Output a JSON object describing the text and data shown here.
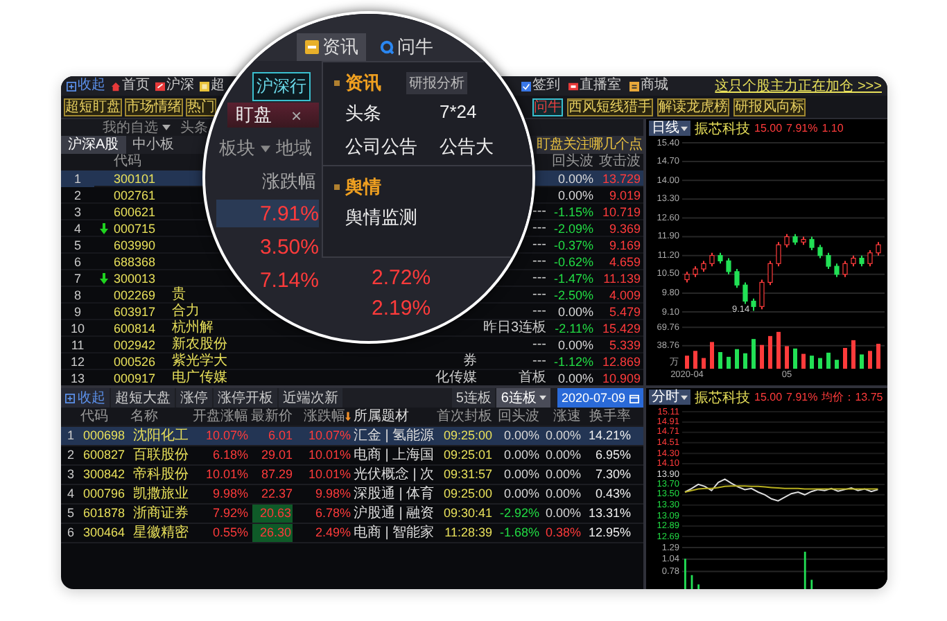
{
  "toolbar": {
    "left": [
      "收起",
      "首页",
      "沪深",
      "超"
    ],
    "right": [
      "签到",
      "直播室",
      "商城"
    ],
    "link": "这只个股主力正在加仓 >>>"
  },
  "quick_buttons": {
    "left": [
      {
        "label": "超短盯盘",
        "selected": false
      },
      {
        "label": "市场情绪",
        "selected": false
      },
      {
        "label": "热门",
        "selected": false
      }
    ],
    "right": [
      {
        "label": "问牛",
        "selected": true
      },
      {
        "label": "西风短线猎手",
        "selected": false
      },
      {
        "label": "解读龙虎榜",
        "selected": false
      },
      {
        "label": "研报风向标",
        "selected": false
      }
    ]
  },
  "watch": {
    "menu": "我的自选",
    "headline": "头条",
    "tabs": [
      {
        "label": "沪深A股",
        "selected": true
      },
      {
        "label": "中小板",
        "selected": false
      }
    ],
    "banner": "盯盘关注哪几个点",
    "columns": {
      "code": "代码",
      "rebound": "回头波",
      "attack": "攻击波"
    },
    "rows": [
      {
        "index": "1",
        "down": false,
        "code": "300101",
        "rebound": "0.00%",
        "falling": false,
        "attack": "13.729",
        "selected": true
      },
      {
        "index": "2",
        "down": false,
        "code": "002761",
        "rebound": "0.00%",
        "falling": false,
        "attack": "9.019",
        "selected": false
      },
      {
        "index": "3",
        "down": false,
        "code": "600621",
        "tag": "---",
        "rebound": "-1.15%",
        "falling": true,
        "attack": "10.719",
        "selected": false
      },
      {
        "index": "4",
        "down": true,
        "code": "000715",
        "tag": "---",
        "rebound": "-2.09%",
        "falling": true,
        "attack": "9.369",
        "selected": false
      },
      {
        "index": "5",
        "down": false,
        "code": "603990",
        "tag": "---",
        "rebound": "-0.37%",
        "falling": true,
        "attack": "9.169",
        "selected": false
      },
      {
        "index": "6",
        "down": false,
        "code": "688368",
        "tag": "---",
        "rebound": "-0.62%",
        "falling": true,
        "attack": "4.659",
        "selected": false
      },
      {
        "index": "7",
        "down": true,
        "code": "300013",
        "tag": "---",
        "rebound": "-1.47%",
        "falling": true,
        "attack": "11.139",
        "selected": false
      },
      {
        "index": "8",
        "down": false,
        "code": "002269",
        "name": "贵",
        "tag": "---",
        "rebound": "-2.50%",
        "falling": true,
        "attack": "4.009",
        "selected": false
      },
      {
        "index": "9",
        "down": false,
        "code": "603917",
        "name": "合力",
        "tag": "---",
        "rebound": "0.00%",
        "falling": false,
        "attack": "5.479",
        "selected": false
      },
      {
        "index": "10",
        "down": false,
        "code": "600814",
        "name": "杭州解",
        "tag": "昨日3连板",
        "rebound": "-2.11%",
        "falling": true,
        "attack": "15.429",
        "selected": false
      },
      {
        "index": "11",
        "down": false,
        "code": "002942",
        "name": "新农股份",
        "tag": "---",
        "rebound": "0.00%",
        "falling": false,
        "attack": "5.339",
        "selected": false
      },
      {
        "index": "12",
        "down": false,
        "code": "000526",
        "name": "紫光学大",
        "concept": "券",
        "tag": "---",
        "rebound": "-1.12%",
        "falling": true,
        "attack": "12.869",
        "selected": false
      },
      {
        "index": "13",
        "down": false,
        "code": "000917",
        "name": "电广传媒",
        "concept": "化传媒",
        "tag": "首板",
        "rebound": "0.00%",
        "falling": false,
        "attack": "10.909",
        "selected": false
      }
    ]
  },
  "board": {
    "collapse": "收起",
    "tabs": [
      {
        "label": "超短大盘",
        "selected": false,
        "dropdown": false
      },
      {
        "label": "涨停",
        "selected": false,
        "dropdown": false
      },
      {
        "label": "涨停开板",
        "selected": false,
        "dropdown": false
      },
      {
        "label": "近端次新",
        "selected": false,
        "dropdown": false
      },
      {
        "label": "5连板",
        "selected": false,
        "dropdown": false
      },
      {
        "label": "6连板",
        "selected": true,
        "dropdown": true
      }
    ],
    "date": "2020-07-09",
    "columns": [
      {
        "label": "代码",
        "sorted": false
      },
      {
        "label": "名称",
        "sorted": false
      },
      {
        "label": "开盘涨幅",
        "sorted": false
      },
      {
        "label": "最新价",
        "sorted": false
      },
      {
        "label": "涨跌幅",
        "sorted": true
      },
      {
        "label": "所属题材",
        "sorted": false
      },
      {
        "label": "首次封板",
        "sorted": false
      },
      {
        "label": "回头波",
        "sorted": false
      },
      {
        "label": "涨速",
        "sorted": false
      },
      {
        "label": "换手率",
        "sorted": false
      }
    ],
    "rows": [
      {
        "index": "1",
        "code": "000698",
        "name": "沈阳化工",
        "open": "10.07%",
        "price": "6.01",
        "price_flash": false,
        "change": "10.07%",
        "concept": "汇金 | 氢能源",
        "time": "09:25:00",
        "rebound": "0.00%",
        "rebound_falling": false,
        "speed": "0.00%",
        "speed_rising": false,
        "turnover": "14.21%",
        "selected": true
      },
      {
        "index": "2",
        "code": "600827",
        "name": "百联股份",
        "open": "6.18%",
        "price": "29.01",
        "price_flash": false,
        "change": "10.01%",
        "concept": "电商 | 上海国",
        "time": "09:25:01",
        "rebound": "0.00%",
        "rebound_falling": false,
        "speed": "0.00%",
        "speed_rising": false,
        "turnover": "6.95%",
        "selected": false
      },
      {
        "index": "3",
        "code": "300842",
        "name": "帝科股份",
        "open": "10.01%",
        "price": "87.29",
        "price_flash": false,
        "change": "10.01%",
        "concept": "光伏概念 | 次",
        "time": "09:31:57",
        "rebound": "0.00%",
        "rebound_falling": false,
        "speed": "0.00%",
        "speed_rising": false,
        "turnover": "7.30%",
        "selected": false
      },
      {
        "index": "4",
        "code": "000796",
        "name": "凯撒旅业",
        "open": "9.98%",
        "price": "22.37",
        "price_flash": false,
        "change": "9.98%",
        "concept": "深股通 | 体育",
        "time": "09:25:00",
        "rebound": "0.00%",
        "rebound_falling": false,
        "speed": "0.00%",
        "speed_rising": false,
        "turnover": "0.43%",
        "selected": false
      },
      {
        "index": "5",
        "code": "601878",
        "name": "浙商证券",
        "open": "7.92%",
        "price": "20.63",
        "price_flash": true,
        "change": "6.78%",
        "concept": "沪股通 | 融资",
        "time": "09:30:41",
        "rebound": "-2.92%",
        "rebound_falling": true,
        "speed": "0.00%",
        "speed_rising": false,
        "turnover": "13.31%",
        "selected": false
      },
      {
        "index": "6",
        "code": "300464",
        "name": "星徽精密",
        "open": "0.55%",
        "price": "26.30",
        "price_flash": true,
        "change": "2.49%",
        "concept": "电商 | 智能家",
        "time": "11:28:39",
        "rebound": "-1.68%",
        "rebound_falling": true,
        "speed": "0.38%",
        "speed_rising": true,
        "turnover": "12.95%",
        "selected": false
      }
    ]
  },
  "kline": {
    "period": "日线",
    "name": "振芯科技",
    "price": "15.00",
    "change": "7.91%",
    "amount": "1.10",
    "low_label": "9.14",
    "chart_data": {
      "type": "candlestick",
      "grid": true,
      "categories": [
        null,
        null,
        null,
        null,
        null,
        null,
        null,
        null,
        null,
        null,
        null,
        null,
        null,
        null,
        null,
        null,
        null,
        null,
        null,
        null,
        null,
        null,
        null,
        null
      ],
      "ylim": [
        9.1,
        15.4
      ],
      "yticks": [
        {
          "value": 15.4,
          "label": "15.40"
        },
        {
          "value": 14.7,
          "label": "14.70"
        },
        {
          "value": 14,
          "label": "14.00"
        },
        {
          "value": 13.3,
          "label": "13.30"
        },
        {
          "value": 12.6,
          "label": "12.60"
        },
        {
          "value": 11.9,
          "label": "11.90"
        },
        {
          "value": 11.2,
          "label": "11.20"
        },
        {
          "value": 10.5,
          "label": "10.50"
        },
        {
          "value": 9.8,
          "label": "9.80"
        },
        {
          "value": 9.1,
          "label": "9.10"
        }
      ],
      "ohlc": [
        [
          10.3,
          10.6,
          10.2,
          10.5
        ],
        [
          10.5,
          10.8,
          10.4,
          10.7
        ],
        [
          10.7,
          11.0,
          10.6,
          10.9
        ],
        [
          10.9,
          11.3,
          10.8,
          11.2
        ],
        [
          11.2,
          11.3,
          10.9,
          11.0
        ],
        [
          11.0,
          11.1,
          10.5,
          10.6
        ],
        [
          10.6,
          10.7,
          10.0,
          10.1
        ],
        [
          10.1,
          10.2,
          9.4,
          9.5
        ],
        [
          9.5,
          9.6,
          9.14,
          9.3
        ],
        [
          9.3,
          10.3,
          9.2,
          10.2
        ],
        [
          10.2,
          11.0,
          10.1,
          10.9
        ],
        [
          10.9,
          11.7,
          10.8,
          11.6
        ],
        [
          11.6,
          12.0,
          11.5,
          11.9
        ],
        [
          11.9,
          12.0,
          11.6,
          11.7
        ],
        [
          11.7,
          11.9,
          11.6,
          11.8
        ],
        [
          11.8,
          11.9,
          11.4,
          11.5
        ],
        [
          11.5,
          11.6,
          11.1,
          11.2
        ],
        [
          11.2,
          11.3,
          10.7,
          10.8
        ],
        [
          10.8,
          10.9,
          10.4,
          10.5
        ],
        [
          10.5,
          11.0,
          10.4,
          10.9
        ],
        [
          10.9,
          11.2,
          10.8,
          11.1
        ],
        [
          11.1,
          11.2,
          10.8,
          10.9
        ],
        [
          10.9,
          11.4,
          10.8,
          11.3
        ],
        [
          11.3,
          11.7,
          11.2,
          11.6
        ]
      ]
    },
    "volume": {
      "unit": "万",
      "chart_data": {
        "type": "bar",
        "grid": true,
        "categories": [
          "2020-04",
          null,
          null,
          null,
          null,
          null,
          null,
          null,
          null,
          null,
          null,
          null,
          "05",
          null,
          null,
          null,
          null,
          null,
          null,
          null,
          null,
          null,
          null,
          null
        ],
        "ylim": [
          0,
          70
        ],
        "yticks": [
          {
            "value": 69.76,
            "label": "69.76"
          },
          {
            "value": 38.76,
            "label": "38.76"
          }
        ],
        "values": [
          22,
          30,
          18,
          45,
          28,
          20,
          33,
          26,
          50,
          40,
          55,
          62,
          38,
          34,
          25,
          22,
          18,
          27,
          15,
          35,
          48,
          24,
          30,
          42
        ]
      }
    }
  },
  "intraday": {
    "period": "分时",
    "name": "振芯科技",
    "price": "15.00",
    "change": "7.91%",
    "avg": "均价：13.75",
    "chart_data": {
      "type": "line",
      "grid": true,
      "ylim": [
        12.69,
        15.11
      ],
      "yticks": [
        {
          "value": 15.11,
          "label": "15.11"
        },
        {
          "value": 14.91,
          "label": "14.91"
        },
        {
          "value": 14.71,
          "label": "14.71"
        },
        {
          "value": 14.51,
          "label": "14.51"
        },
        {
          "value": 14.3,
          "label": "14.30"
        },
        {
          "value": 14.1,
          "label": "14.10"
        },
        {
          "value": 13.9,
          "label": "13.90"
        },
        {
          "value": 13.7,
          "label": "13.70"
        },
        {
          "value": 13.5,
          "label": "13.50"
        },
        {
          "value": 13.3,
          "label": "13.30"
        },
        {
          "value": 13.09,
          "label": "13.09"
        },
        {
          "value": 12.89,
          "label": "12.89"
        },
        {
          "value": 12.69,
          "label": "12.69"
        }
      ],
      "series": [
        {
          "color": "#dddddd",
          "values": [
            13.55,
            13.62,
            13.7,
            13.66,
            13.58,
            13.74,
            13.8,
            13.72,
            13.65,
            13.6,
            13.62,
            13.55,
            13.5,
            13.42,
            13.38,
            13.45,
            13.52,
            13.55,
            13.5,
            13.56,
            13.6,
            13.58,
            13.62,
            13.57,
            13.6,
            13.63,
            13.58,
            13.61,
            13.56,
            13.6
          ]
        },
        {
          "color": "#b8b020",
          "values": [
            13.55,
            13.58,
            13.61,
            13.62,
            13.62,
            13.64,
            13.66,
            13.67,
            13.67,
            13.67,
            13.66,
            13.66,
            13.65,
            13.64,
            13.63,
            13.62,
            13.62,
            13.62,
            13.61,
            13.61,
            13.61,
            13.61,
            13.61,
            13.61,
            13.61,
            13.61,
            13.61,
            13.61,
            13.61,
            13.61
          ]
        }
      ]
    },
    "volume": {
      "chart_data": {
        "type": "bar",
        "grid": true,
        "ylim": [
          0.4,
          1.29
        ],
        "yticks": [
          {
            "value": 1.29,
            "label": "1.29"
          },
          {
            "value": 1.04,
            "label": "1.04"
          },
          {
            "value": 0.78,
            "label": "0.78"
          }
        ],
        "color": "#22e055",
        "values": [
          1.05,
          0.7,
          0.5,
          null,
          null,
          null,
          null,
          null,
          null,
          null,
          null,
          null,
          null,
          null,
          null,
          null,
          null,
          null,
          1.2,
          0.6,
          null,
          null,
          null,
          null,
          null,
          null,
          null,
          null,
          null,
          null
        ]
      }
    }
  },
  "lens": {
    "tabs": [
      {
        "label": "资讯",
        "selected": true
      },
      {
        "label": "问牛",
        "selected": false
      }
    ],
    "market_button": "沪深行",
    "watch_tab": "盯盘",
    "close": "×",
    "filter": "板块",
    "region": "地域",
    "column": "涨跌幅",
    "values": [
      {
        "label": "7.91%",
        "selected": true
      },
      {
        "label": "3.50%",
        "selected": false
      },
      {
        "label": "7.14%",
        "selected": false
      }
    ],
    "values_2": [
      "2.72%",
      "2.19%"
    ],
    "side_tab": "研报分析",
    "menu": [
      {
        "title": "资讯",
        "items": [
          "头条",
          "7*24",
          "公司公告",
          "公告大"
        ]
      },
      {
        "title": "舆情",
        "items": [
          "舆情监测"
        ]
      }
    ]
  }
}
